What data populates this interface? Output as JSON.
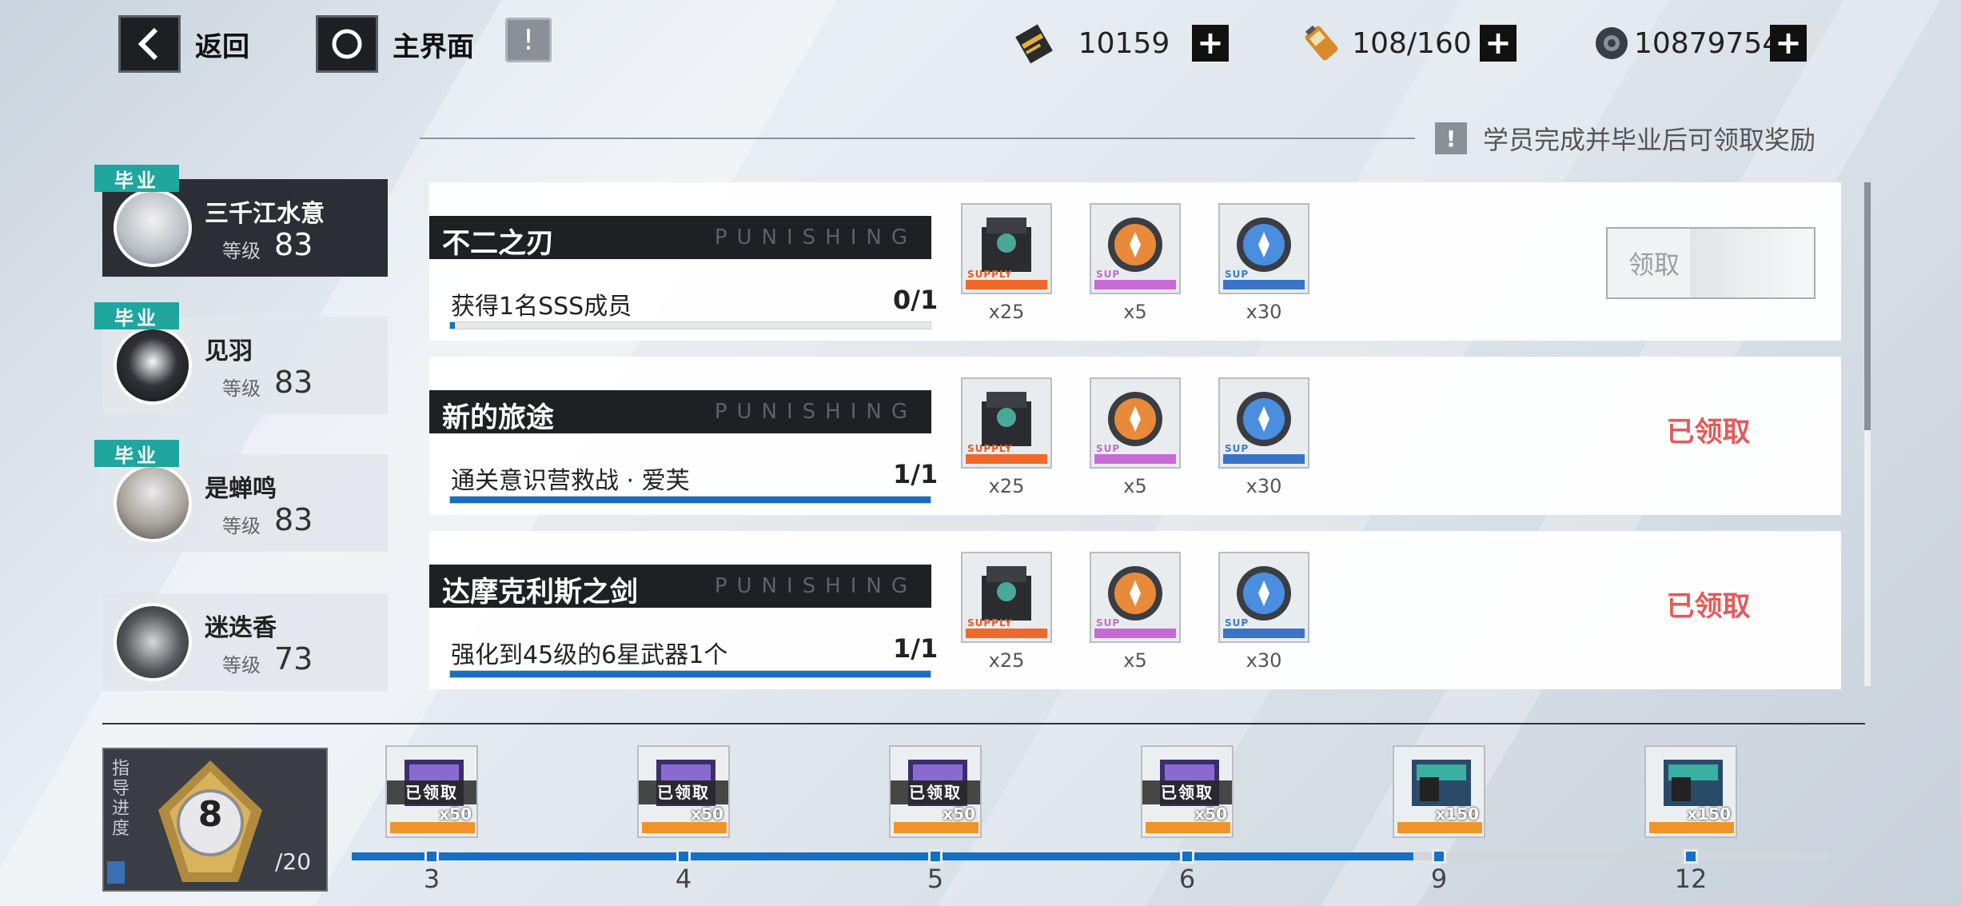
{
  "top": {
    "back_label": "返回",
    "main_label": "主界面",
    "info_icon": "info-icon",
    "resources": [
      {
        "name": "card-icon",
        "value": "10159"
      },
      {
        "name": "battery-icon",
        "value": "108/160"
      },
      {
        "name": "gear-coin-icon",
        "value": "10879754"
      }
    ]
  },
  "hint": "学员完成并毕业后可领取奖励",
  "students": [
    {
      "name": "三千江水意",
      "level_label": "等级",
      "level": "83",
      "graduated": "毕业",
      "selected": true
    },
    {
      "name": "见羽",
      "level_label": "等级",
      "level": "83",
      "graduated": "毕业",
      "selected": false
    },
    {
      "name": "是蝉鸣",
      "level_label": "等级",
      "level": "83",
      "graduated": "毕业",
      "selected": false
    },
    {
      "name": "迷迭香",
      "level_label": "等级",
      "level": "73",
      "graduated": "",
      "selected": false
    }
  ],
  "missions": [
    {
      "title": "不二之刃",
      "watermark": "PUNISHING",
      "desc": "获得1名SSS成员",
      "progress": "0/1",
      "fraction": 0.0,
      "rewards": [
        {
          "qty": "x25",
          "label": "SUPPLY"
        },
        {
          "qty": "x5",
          "label": "SUP"
        },
        {
          "qty": "x30",
          "label": "SUP"
        }
      ],
      "status": "领取",
      "claimed": false
    },
    {
      "title": "新的旅途",
      "watermark": "PUNISHING",
      "desc": "通关意识营救战 · 爱芙",
      "progress": "1/1",
      "fraction": 1.0,
      "rewards": [
        {
          "qty": "x25",
          "label": "SUPPLY"
        },
        {
          "qty": "x5",
          "label": "SUP"
        },
        {
          "qty": "x30",
          "label": "SUP"
        }
      ],
      "status": "已领取",
      "claimed": true
    },
    {
      "title": "达摩克利斯之剑",
      "watermark": "PUNISHING",
      "desc": "强化到45级的6星武器1个",
      "progress": "1/1",
      "fraction": 1.0,
      "rewards": [
        {
          "qty": "x25",
          "label": "SUPPLY"
        },
        {
          "qty": "x5",
          "label": "SUP"
        },
        {
          "qty": "x30",
          "label": "SUP"
        }
      ],
      "status": "已领取",
      "claimed": true
    }
  ],
  "guide": {
    "label": "指导进度",
    "level": "8",
    "total": "/20",
    "milestones": [
      {
        "at": "3",
        "qty": "x50",
        "done": "已领取",
        "claimed": true
      },
      {
        "at": "4",
        "qty": "x50",
        "done": "已领取",
        "claimed": true
      },
      {
        "at": "5",
        "qty": "x50",
        "done": "已领取",
        "claimed": true
      },
      {
        "at": "6",
        "qty": "x50",
        "done": "已领取",
        "claimed": true
      },
      {
        "at": "9",
        "qty": "x150",
        "done": "",
        "claimed": false
      },
      {
        "at": "12",
        "qty": "x150",
        "done": "",
        "claimed": false
      }
    ],
    "progress_fraction": 0.72
  },
  "colors": {
    "accent_blue": "#1470c4",
    "claimed_red": "#e55a5a",
    "graduate_teal": "#1fa69e"
  }
}
